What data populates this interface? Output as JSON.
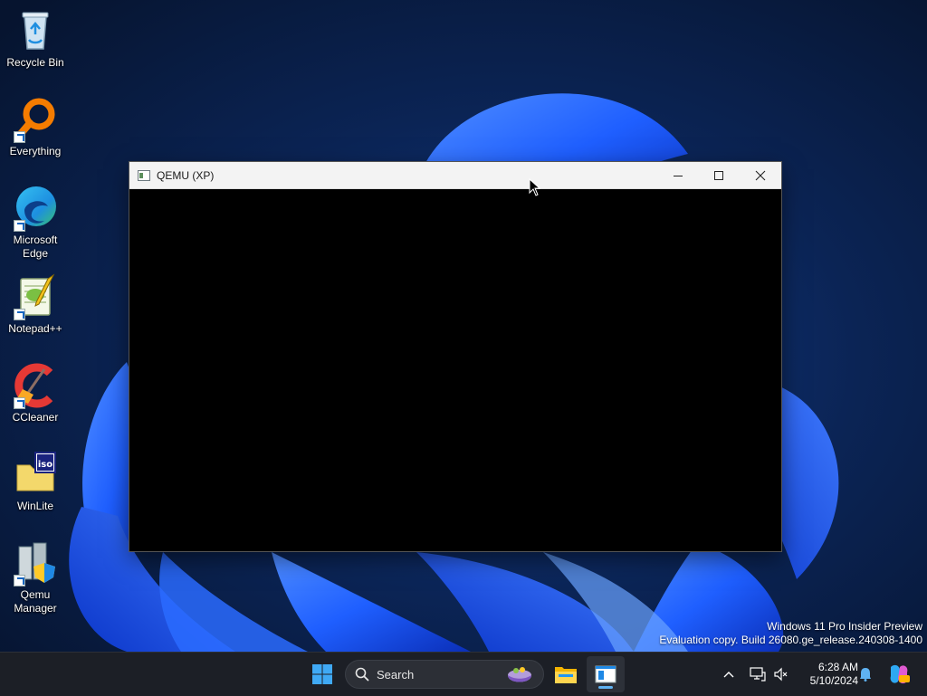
{
  "desktop": {
    "icons": [
      {
        "label": "Recycle Bin"
      },
      {
        "label": "Everything"
      },
      {
        "label": "Microsoft\nEdge"
      },
      {
        "label": "Notepad++"
      },
      {
        "label": "CCleaner"
      },
      {
        "label": "WinLite"
      },
      {
        "label": "Qemu\nManager"
      }
    ]
  },
  "window": {
    "title": "QEMU (XP)"
  },
  "watermark": {
    "line1": "Windows 11 Pro Insider Preview",
    "line2": "Evaluation copy. Build 26080.ge_release.240308-1400"
  },
  "taskbar": {
    "search_label": "Search",
    "clock_time": "6:28 AM",
    "clock_date": "5/10/2024"
  },
  "colors": {
    "accent": "#5fb2f2",
    "taskbar_bg": "#1c1f26",
    "wallpaper_bloom": "#1f5fff"
  }
}
